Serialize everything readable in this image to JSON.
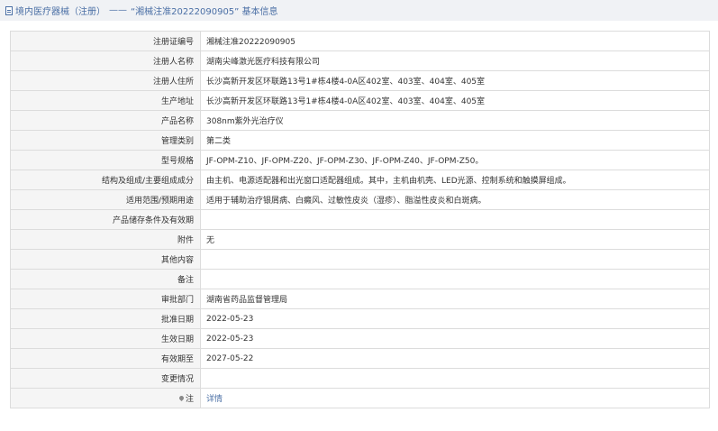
{
  "header": {
    "link": "境内医疗器械（注册）",
    "separator": "——",
    "title": "“湘械注准20222090905” 基本信息"
  },
  "rows": [
    {
      "label": "注册证编号",
      "value": "湘械注准20222090905"
    },
    {
      "label": "注册人名称",
      "value": "湖南尖峰激光医疗科技有限公司"
    },
    {
      "label": "注册人住所",
      "value": "长沙高新开发区环联路13号1#栋4楼4-0A区402室、403室、404室、405室"
    },
    {
      "label": "生产地址",
      "value": "长沙高新开发区环联路13号1#栋4楼4-0A区402室、403室、404室、405室"
    },
    {
      "label": "产品名称",
      "value": "308nm紫外光治疗仪"
    },
    {
      "label": "管理类别",
      "value": "第二类"
    },
    {
      "label": "型号规格",
      "value": "JF-OPM-Z10、JF-OPM-Z20、JF-OPM-Z30、JF-OPM-Z40、JF-OPM-Z50。"
    },
    {
      "label": "结构及组成/主要组成成分",
      "value": "由主机、电源适配器和出光窗口适配器组成。其中，主机由机壳、LED光源、控制系统和触摸屏组成。"
    },
    {
      "label": "适用范围/预期用途",
      "value": "适用于辅助治疗银屑病、白癜风、过敏性皮炎（湿疹）、脂溢性皮炎和白斑病。"
    },
    {
      "label": "产品储存条件及有效期",
      "value": ""
    },
    {
      "label": "附件",
      "value": "无"
    },
    {
      "label": "其他内容",
      "value": ""
    },
    {
      "label": "备注",
      "value": ""
    },
    {
      "label": "审批部门",
      "value": "湖南省药品监督管理局"
    },
    {
      "label": "批准日期",
      "value": "2022-05-23"
    },
    {
      "label": "生效日期",
      "value": "2022-05-23"
    },
    {
      "label": "有效期至",
      "value": "2027-05-22"
    },
    {
      "label": "变更情况",
      "value": ""
    }
  ],
  "note_row": {
    "label": "注",
    "link": "详情"
  }
}
